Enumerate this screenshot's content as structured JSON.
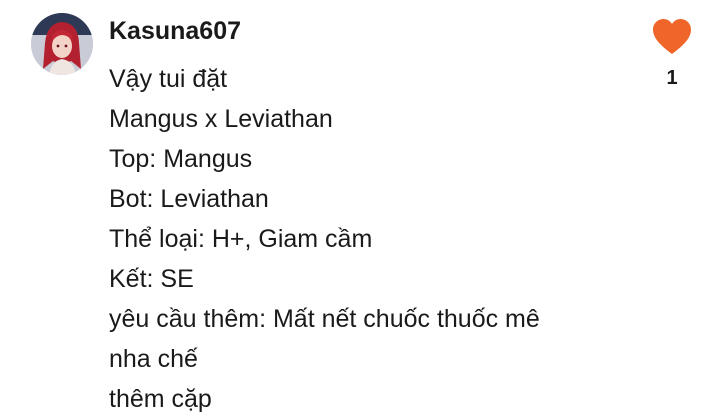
{
  "comment": {
    "author": "Kasuna607",
    "lines": [
      "Vậy tui đặt",
      "Mangus x Leviathan",
      "Top: Mangus",
      "Bot: Leviathan",
      "Thể loại: H+, Giam cầm",
      "Kết: SE",
      "yêu cầu thêm: Mất nết chuốc thuốc mê",
      "nha chế",
      "thêm cặp"
    ],
    "avatar_icon": "user-avatar-icon",
    "like_icon": "heart-icon",
    "like_color": "#f0662a",
    "like_count": "1",
    "liked": true
  }
}
